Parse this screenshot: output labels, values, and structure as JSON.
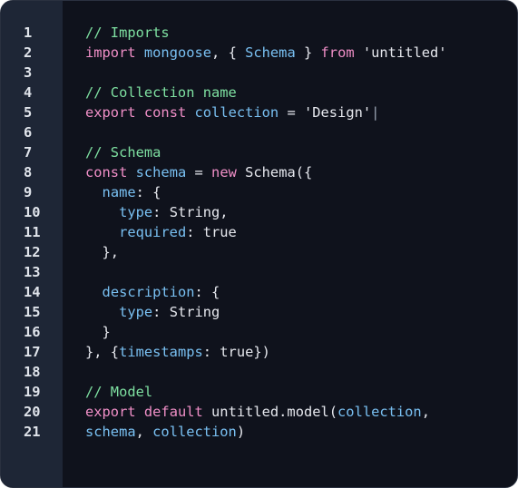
{
  "editor": {
    "colors": {
      "background": "#0f121c",
      "gutter": "#1e2636",
      "comment": "#7ee0a1",
      "keyword": "#f08fc7",
      "identifier": "#79c0f2",
      "plain": "#e6e8ee"
    },
    "lines": [
      {
        "number": "1",
        "tokens": [
          {
            "t": "    ",
            "c": "plain"
          },
          {
            "t": "// Imports",
            "c": "comment"
          }
        ]
      },
      {
        "number": "2",
        "tokens": [
          {
            "t": "import",
            "c": "keyword"
          },
          {
            "t": " ",
            "c": "plain"
          },
          {
            "t": "mongoose",
            "c": "ident"
          },
          {
            "t": ", { ",
            "c": "plain"
          },
          {
            "t": "Schema",
            "c": "ident"
          },
          {
            "t": " } ",
            "c": "plain"
          },
          {
            "t": "from",
            "c": "keyword"
          },
          {
            "t": " 'untitled'",
            "c": "string"
          }
        ]
      },
      {
        "number": "3",
        "tokens": []
      },
      {
        "number": "4",
        "tokens": [
          {
            "t": "// Collection name",
            "c": "comment"
          }
        ]
      },
      {
        "number": "5",
        "tokens": [
          {
            "t": "export",
            "c": "keyword"
          },
          {
            "t": " ",
            "c": "plain"
          },
          {
            "t": "const",
            "c": "keyword"
          },
          {
            "t": " ",
            "c": "plain"
          },
          {
            "t": "collection",
            "c": "ident"
          },
          {
            "t": " = 'Design'",
            "c": "string"
          },
          {
            "t": "|",
            "c": "cursor"
          }
        ]
      },
      {
        "number": "6",
        "tokens": []
      },
      {
        "number": "7",
        "tokens": [
          {
            "t": "// Schema",
            "c": "comment"
          }
        ]
      },
      {
        "number": "8",
        "tokens": [
          {
            "t": "const",
            "c": "keyword"
          },
          {
            "t": " ",
            "c": "plain"
          },
          {
            "t": "schema",
            "c": "ident"
          },
          {
            "t": " = ",
            "c": "plain"
          },
          {
            "t": "new",
            "c": "keyword"
          },
          {
            "t": " Schema({",
            "c": "plain"
          }
        ]
      },
      {
        "number": "9",
        "tokens": [
          {
            "t": "  ",
            "c": "plain"
          },
          {
            "t": "name",
            "c": "ident"
          },
          {
            "t": ": {",
            "c": "plain"
          }
        ]
      },
      {
        "number": "10",
        "tokens": [
          {
            "t": "    ",
            "c": "plain"
          },
          {
            "t": "type",
            "c": "ident"
          },
          {
            "t": ": String,",
            "c": "plain"
          }
        ]
      },
      {
        "number": "11",
        "tokens": [
          {
            "t": "    ",
            "c": "plain"
          },
          {
            "t": "required",
            "c": "ident"
          },
          {
            "t": ": true",
            "c": "plain"
          }
        ]
      },
      {
        "number": "12",
        "tokens": [
          {
            "t": "  },",
            "c": "plain"
          }
        ]
      },
      {
        "number": "13",
        "tokens": []
      },
      {
        "number": "14",
        "tokens": [
          {
            "t": "  ",
            "c": "plain"
          },
          {
            "t": "description",
            "c": "ident"
          },
          {
            "t": ": {",
            "c": "plain"
          }
        ]
      },
      {
        "number": "15",
        "tokens": [
          {
            "t": "    ",
            "c": "plain"
          },
          {
            "t": "type",
            "c": "ident"
          },
          {
            "t": ": String",
            "c": "plain"
          }
        ]
      },
      {
        "number": "16",
        "tokens": [
          {
            "t": "  }",
            "c": "plain"
          }
        ]
      },
      {
        "number": "17",
        "tokens": [
          {
            "t": "}, {",
            "c": "plain"
          },
          {
            "t": "timestamps",
            "c": "ident"
          },
          {
            "t": ": true})",
            "c": "plain"
          }
        ]
      },
      {
        "number": "18",
        "tokens": []
      },
      {
        "number": "19",
        "tokens": [
          {
            "t": "// Model",
            "c": "comment"
          }
        ]
      },
      {
        "number": "20",
        "tokens": [
          {
            "t": "export",
            "c": "keyword"
          },
          {
            "t": " ",
            "c": "plain"
          },
          {
            "t": "default",
            "c": "keyword"
          },
          {
            "t": " untitled.model(",
            "c": "plain"
          },
          {
            "t": "collection",
            "c": "ident"
          },
          {
            "t": ",",
            "c": "plain"
          }
        ]
      },
      {
        "number": "21",
        "tokens": [
          {
            "t": "schema",
            "c": "ident"
          },
          {
            "t": ", ",
            "c": "plain"
          },
          {
            "t": "collection",
            "c": "ident"
          },
          {
            "t": ")",
            "c": "plain"
          }
        ]
      }
    ]
  }
}
